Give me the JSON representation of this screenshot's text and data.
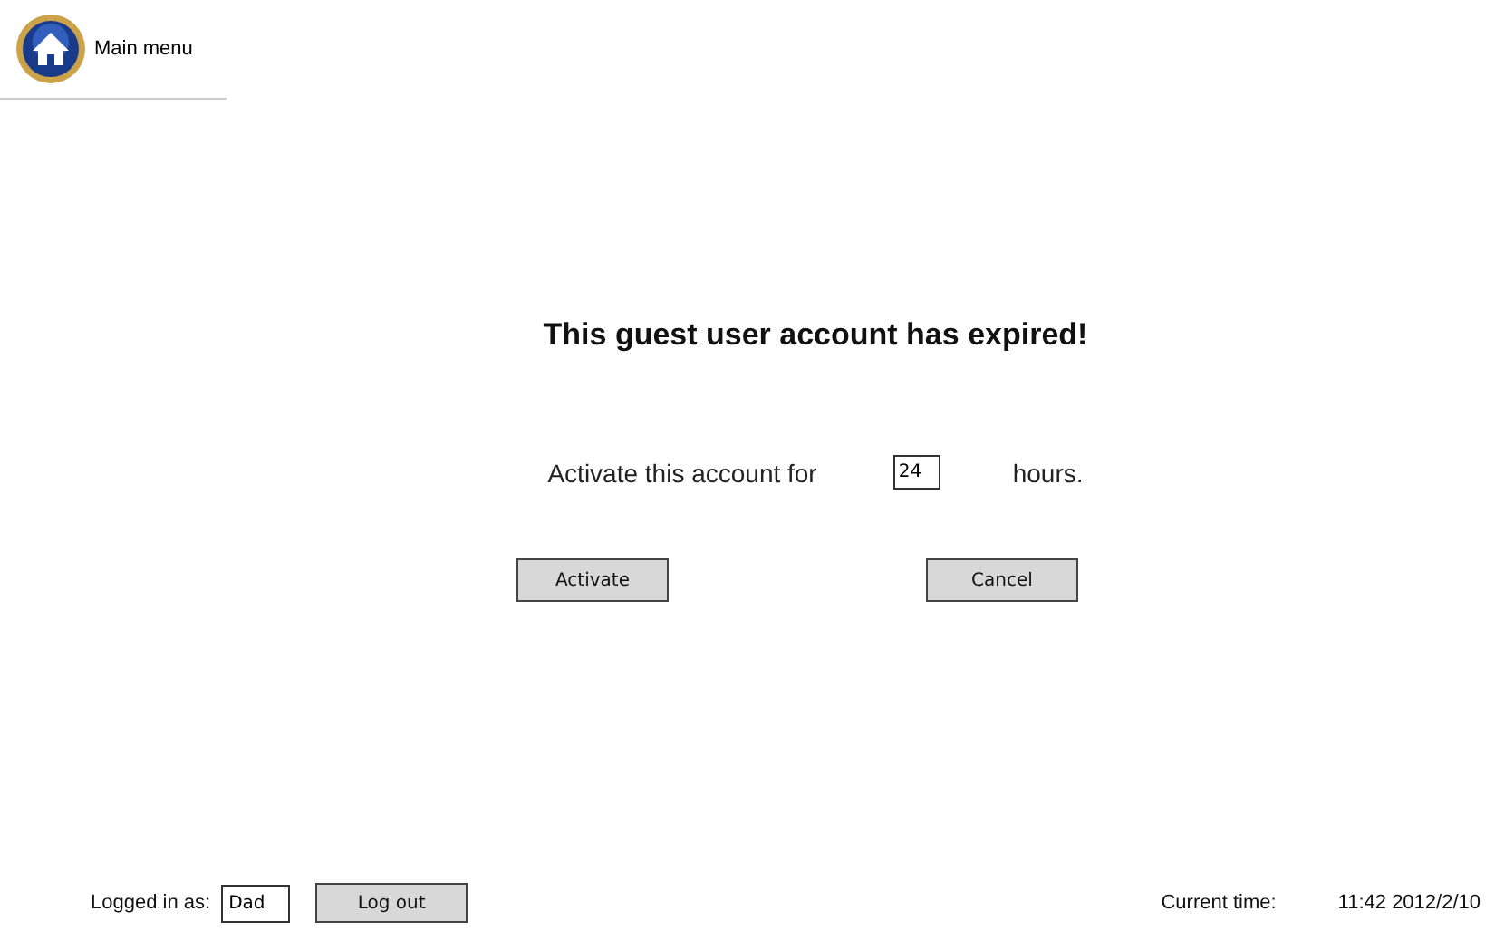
{
  "main_menu": {
    "label": "Main menu"
  },
  "heading": "This guest user account has expired!",
  "activation": {
    "prefix": "Activate this account for",
    "hours": "24",
    "suffix": "hours."
  },
  "buttons": [
    "Activate",
    "Cancel"
  ],
  "footer": {
    "logged_in_label": "Logged in as:",
    "user": "Dad",
    "logout": "Log out",
    "time_label": "Current time:",
    "time": "11:42 2012/2/10"
  }
}
